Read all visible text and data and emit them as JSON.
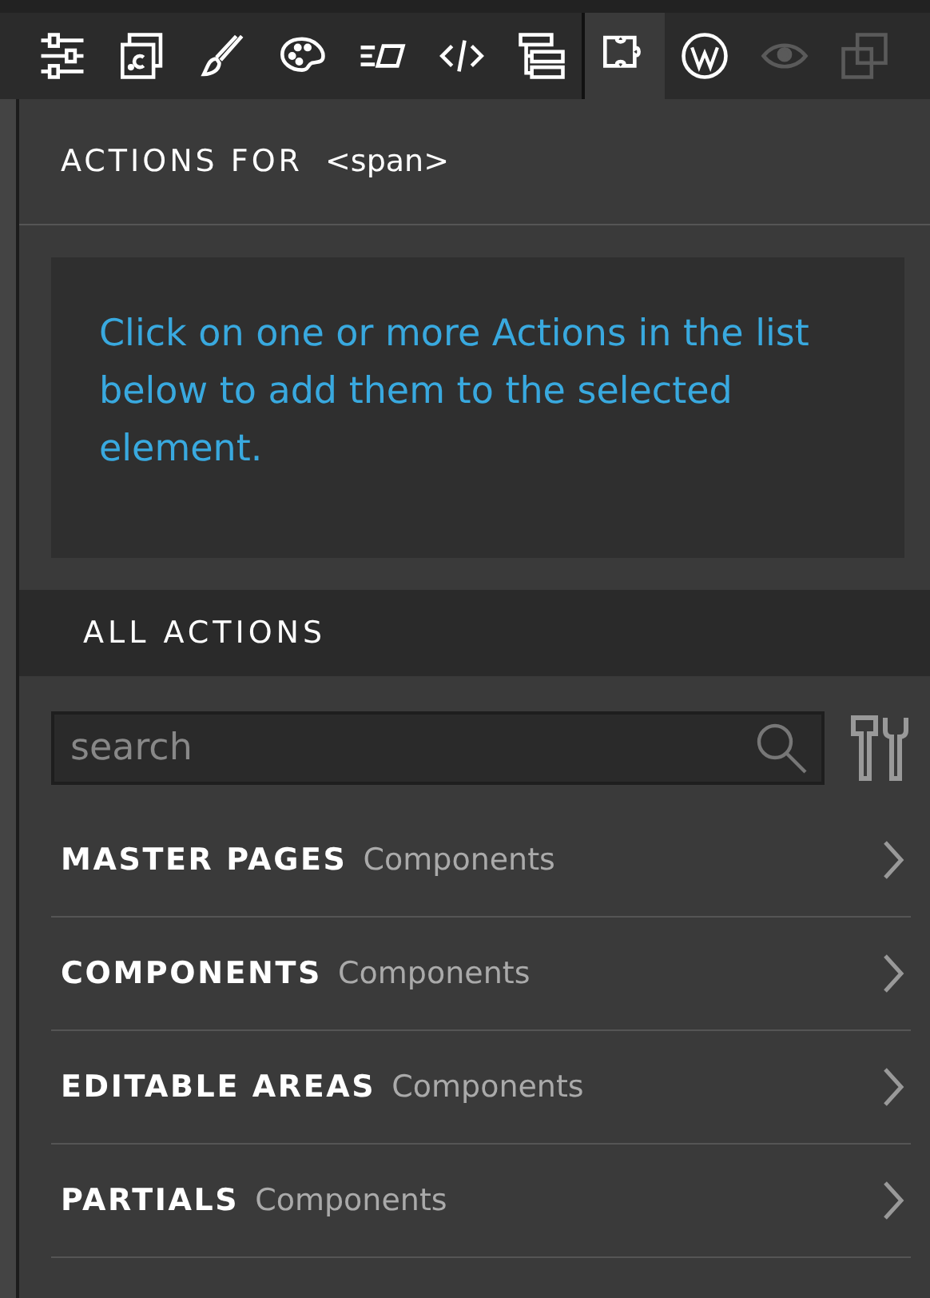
{
  "toolbar": {
    "tools": [
      {
        "selected": false,
        "disabled": false
      },
      {
        "selected": false,
        "disabled": false
      },
      {
        "selected": false,
        "disabled": false
      },
      {
        "selected": false,
        "disabled": false
      },
      {
        "selected": false,
        "disabled": false
      },
      {
        "selected": false,
        "disabled": false
      },
      {
        "selected": false,
        "disabled": false
      },
      {
        "selected": true,
        "disabled": false
      },
      {
        "selected": false,
        "disabled": false
      },
      {
        "selected": false,
        "disabled": true
      },
      {
        "selected": false,
        "disabled": true
      }
    ]
  },
  "panel": {
    "title": "ACTIONS FOR",
    "element": "<span>",
    "hint": "Click on one or more Actions in the list below to add them to the selected element."
  },
  "all_actions": {
    "title": "ALL ACTIONS",
    "search": {
      "placeholder": "search"
    },
    "groups": [
      {
        "name": "MASTER PAGES",
        "category": "Components"
      },
      {
        "name": "COMPONENTS",
        "category": "Components"
      },
      {
        "name": "EDITABLE AREAS",
        "category": "Components"
      },
      {
        "name": "PARTIALS",
        "category": "Components"
      }
    ]
  }
}
